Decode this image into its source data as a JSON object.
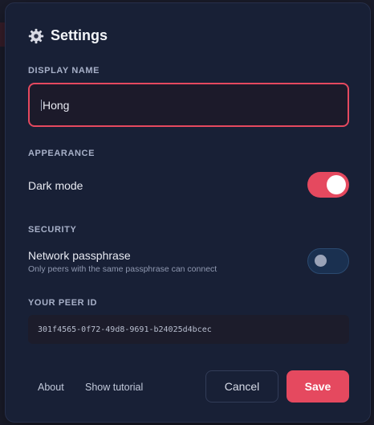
{
  "dialog": {
    "title": "Settings",
    "icon": "gear-icon"
  },
  "display_name": {
    "label": "DISPLAY NAME",
    "value": "Hong"
  },
  "appearance": {
    "label": "APPEARANCE",
    "dark_mode_label": "Dark mode",
    "dark_mode_on": true
  },
  "security": {
    "label": "SECURITY",
    "passphrase_label": "Network passphrase",
    "passphrase_hint": "Only peers with the same passphrase can connect",
    "passphrase_on": false
  },
  "peer": {
    "label": "YOUR PEER ID",
    "id": "301f4565-0f72-49d8-9691-b24025d4bcec"
  },
  "footer": {
    "about": "About",
    "tutorial": "Show tutorial",
    "cancel": "Cancel",
    "save": "Save"
  },
  "colors": {
    "accent": "#e5495f",
    "panel": "#182036",
    "background": "#1b1d2c"
  }
}
